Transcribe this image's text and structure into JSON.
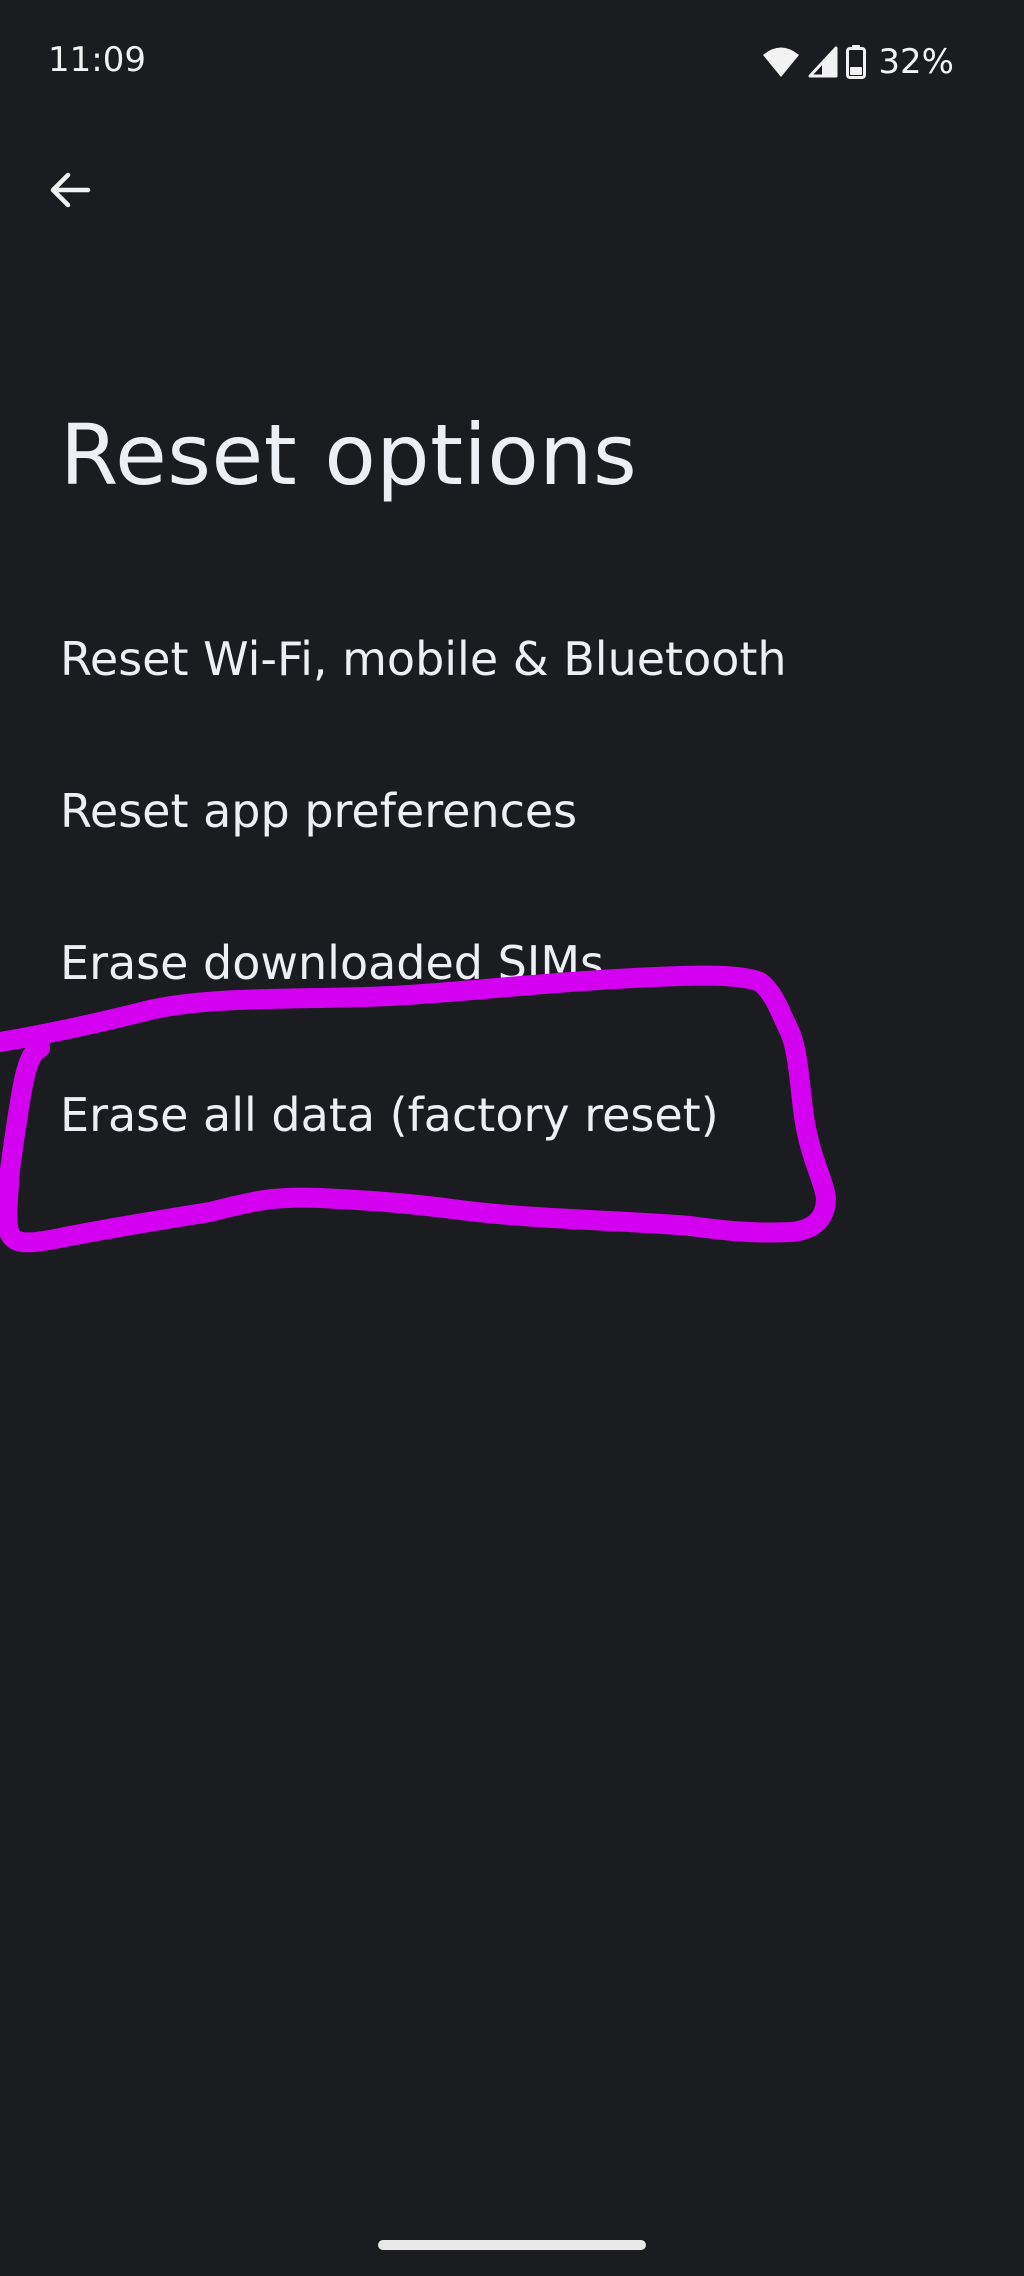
{
  "status_bar": {
    "time": "11:09",
    "battery_percent": "32%",
    "icons": [
      "wifi-icon",
      "signal-icon",
      "battery-icon"
    ]
  },
  "toolbar": {
    "back_icon": "arrow-back-icon"
  },
  "page": {
    "title": "Reset options"
  },
  "options": [
    {
      "label": "Reset Wi-Fi, mobile & Bluetooth"
    },
    {
      "label": "Reset app preferences"
    },
    {
      "label": "Erase downloaded SIMs"
    },
    {
      "label": "Erase all data (factory reset)"
    }
  ],
  "annotation": {
    "color": "#d400f0",
    "target": "Erase all data (factory reset)"
  },
  "colors": {
    "background": "#1b1c1f",
    "text": "#eceff3"
  }
}
